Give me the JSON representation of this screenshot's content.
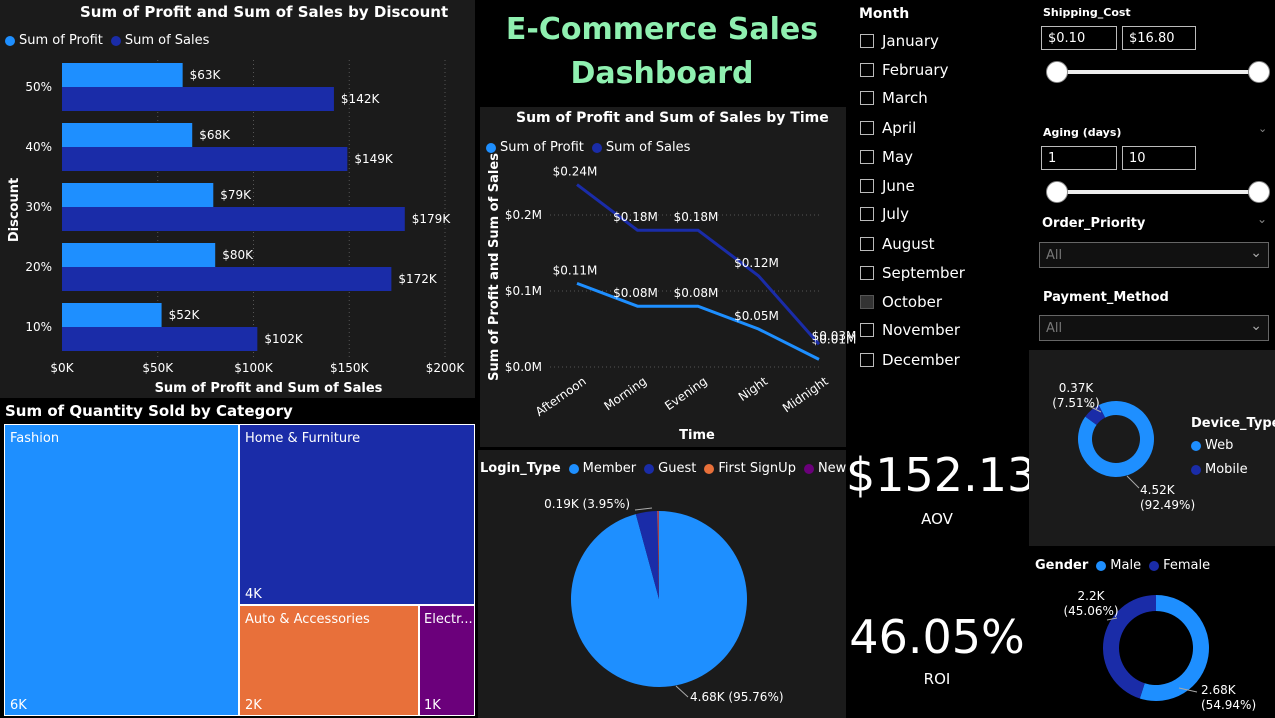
{
  "title": "E-Commerce Sales Dashboard",
  "title_lines": [
    "E-Commerce Sales",
    "Dashboard"
  ],
  "colors": {
    "profit": "#1e8fff",
    "sales": "#1a2ca8",
    "orange": "#e8703a",
    "purple": "#6b007b",
    "title_green": "#8ff0b0"
  },
  "chart_data": [
    {
      "id": "discount",
      "type": "bar",
      "title": "Sum of Profit and Sum of Sales by Discount",
      "xlabel": "Sum of Profit and Sum of Sales",
      "ylabel": "Discount",
      "categories": [
        "50%",
        "40%",
        "30%",
        "20%",
        "10%"
      ],
      "series": [
        {
          "name": "Sum of Profit",
          "values": [
            63,
            68,
            79,
            80,
            52
          ],
          "labels": [
            "$63K",
            "$68K",
            "$79K",
            "$80K",
            "$52K"
          ]
        },
        {
          "name": "Sum of Sales",
          "values": [
            142,
            149,
            179,
            172,
            102
          ],
          "labels": [
            "$142K",
            "$149K",
            "$179K",
            "$172K",
            "$102K"
          ]
        }
      ],
      "xlim": [
        0,
        200
      ],
      "xticks": [
        0,
        50,
        100,
        150,
        200
      ],
      "xtick_labels": [
        "$0K",
        "$50K",
        "$100K",
        "$150K",
        "$200K"
      ],
      "legend": "top-left"
    },
    {
      "id": "time",
      "type": "line",
      "title": "Sum of Profit and Sum of Sales by Time",
      "xlabel": "Time",
      "ylabel": "Sum of Profit and Sum of Sales",
      "categories": [
        "Afternoon",
        "Morning",
        "Evening",
        "Night",
        "Midnight"
      ],
      "series": [
        {
          "name": "Sum of Profit",
          "values": [
            0.11,
            0.08,
            0.08,
            0.05,
            0.01
          ],
          "labels": [
            "$0.11M",
            "$0.08M",
            "$0.08M",
            "$0.05M",
            "$0.01M"
          ]
        },
        {
          "name": "Sum of Sales",
          "values": [
            0.24,
            0.18,
            0.18,
            0.12,
            0.03
          ],
          "labels": [
            "$0.24M",
            "$0.18M",
            "$0.18M",
            "$0.12M",
            "$0.03M"
          ]
        }
      ],
      "ylim": [
        0,
        0.25
      ],
      "yticks": [
        0,
        0.1,
        0.2
      ],
      "ytick_labels": [
        "$0.0M",
        "$0.1M",
        "$0.2M"
      ],
      "legend": "top-left"
    },
    {
      "id": "category",
      "type": "treemap",
      "title": "Sum of Quantity Sold by Category",
      "items": [
        {
          "name": "Fashion",
          "value": 6,
          "label": "6K"
        },
        {
          "name": "Home & Furniture",
          "value": 4,
          "label": "4K"
        },
        {
          "name": "Auto & Accessories",
          "value": 2,
          "label": "2K"
        },
        {
          "name": "Electr...",
          "value": 1,
          "label": "1K"
        }
      ]
    },
    {
      "id": "login",
      "type": "pie",
      "legend_title": "Login_Type",
      "legend": "top",
      "slices": [
        {
          "name": "Member",
          "value": 95.76,
          "label": "4.68K (95.76%)"
        },
        {
          "name": "Guest",
          "value": 3.95,
          "label": "0.19K (3.95%)"
        },
        {
          "name": "First SignUp",
          "value": 0.2,
          "label": ""
        },
        {
          "name": "New",
          "value": 0.09,
          "label": ""
        }
      ]
    },
    {
      "id": "device",
      "type": "donut",
      "legend_title": "Device_Type",
      "legend": "right",
      "slices": [
        {
          "name": "Web",
          "value": 92.49,
          "label_value": "4.52K",
          "label_pct": "(92.49%)"
        },
        {
          "name": "Mobile",
          "value": 7.51,
          "label_value": "0.37K",
          "label_pct": "(7.51%)"
        }
      ]
    },
    {
      "id": "gender",
      "type": "donut",
      "legend_title": "Gender",
      "legend": "top",
      "slices": [
        {
          "name": "Male",
          "value": 54.94,
          "label_value": "2.68K",
          "label_pct": "(54.94%)"
        },
        {
          "name": "Female",
          "value": 45.06,
          "label_value": "2.2K",
          "label_pct": "(45.06%)"
        }
      ]
    }
  ],
  "filters": {
    "month": {
      "label": "Month",
      "options": [
        "January",
        "February",
        "March",
        "April",
        "May",
        "June",
        "July",
        "August",
        "September",
        "October",
        "November",
        "December"
      ],
      "selected": [
        "October"
      ]
    },
    "shipping_cost": {
      "label": "Shipping_Cost",
      "min": "$0.10",
      "max": "$16.80"
    },
    "aging": {
      "label": "Aging (days)",
      "min": "1",
      "max": "10"
    },
    "order_priority": {
      "label": "Order_Priority",
      "value": "All"
    },
    "payment_method": {
      "label": "Payment_Method",
      "value": "All"
    }
  },
  "kpis": {
    "aov": {
      "value": "$152.13",
      "label": "AOV"
    },
    "roi": {
      "value": "46.05%",
      "label": "ROI"
    }
  }
}
